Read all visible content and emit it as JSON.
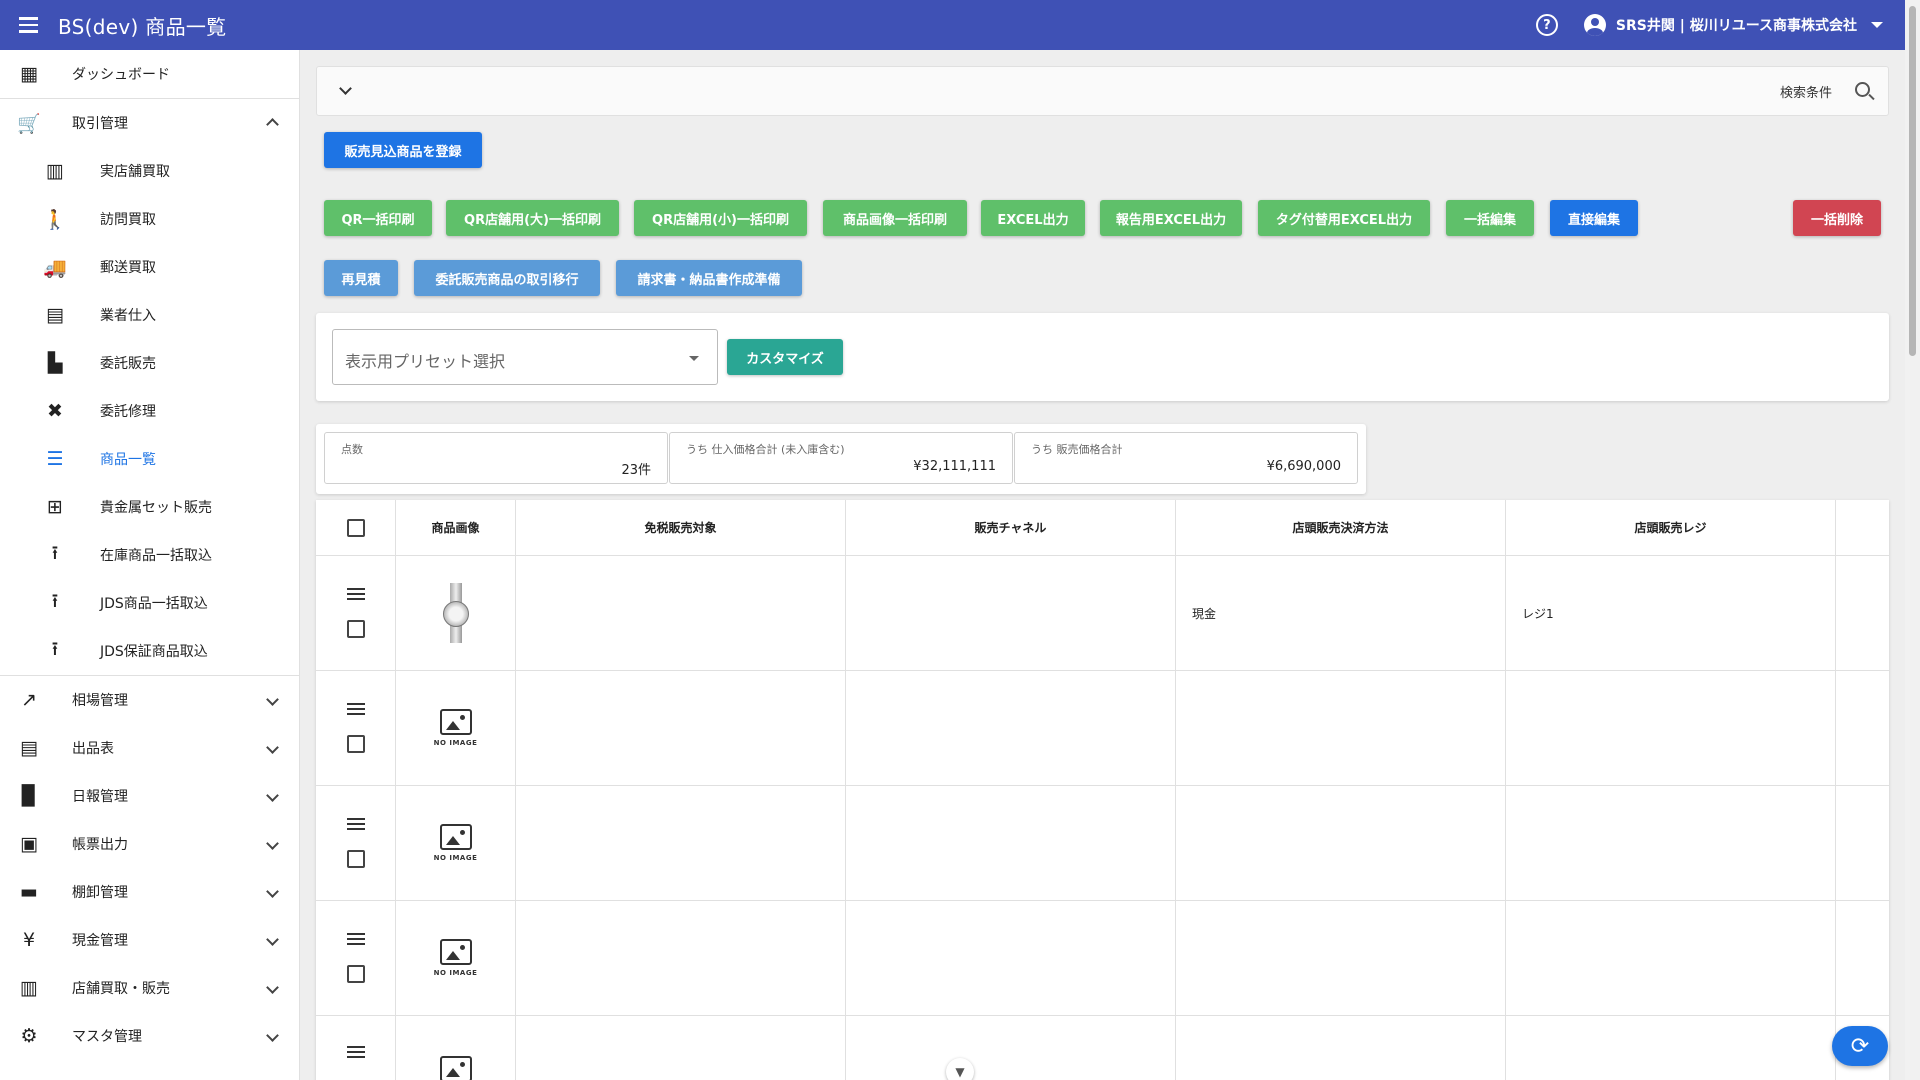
{
  "header": {
    "title": "BS(dev) 商品一覧",
    "user": "SRS井関 | 桜川リユース商事株式会社"
  },
  "sidebar": {
    "items": [
      {
        "label": "ダッシュボード",
        "icon": "dashboard-icon"
      },
      {
        "label": "取引管理",
        "icon": "cart-icon",
        "expanded": true
      },
      {
        "label": "実店舗買取",
        "icon": "store-icon"
      },
      {
        "label": "訪問買取",
        "icon": "walk-icon"
      },
      {
        "label": "郵送買取",
        "icon": "truck-icon"
      },
      {
        "label": "業者仕入",
        "icon": "building-icon"
      },
      {
        "label": "委託販売",
        "icon": "counter-icon"
      },
      {
        "label": "委託修理",
        "icon": "tools-icon"
      },
      {
        "label": "商品一覧",
        "icon": "list-icon",
        "active": true
      },
      {
        "label": "貴金属セット販売",
        "icon": "grid-icon"
      },
      {
        "label": "在庫商品一括取込",
        "icon": "upload-icon"
      },
      {
        "label": "JDS商品一括取込",
        "icon": "upload-icon"
      },
      {
        "label": "JDS保証商品取込",
        "icon": "upload-icon"
      },
      {
        "label": "相場管理",
        "icon": "trending-icon"
      },
      {
        "label": "出品表",
        "icon": "listalt-icon"
      },
      {
        "label": "日報管理",
        "icon": "document-icon"
      },
      {
        "label": "帳票出力",
        "icon": "note-icon"
      },
      {
        "label": "棚卸管理",
        "icon": "archive-icon"
      },
      {
        "label": "現金管理",
        "icon": "yen-icon"
      },
      {
        "label": "店舗買取・販売",
        "icon": "store-icon"
      },
      {
        "label": "マスタ管理",
        "icon": "gear-icon"
      }
    ]
  },
  "search": {
    "label": "検索条件"
  },
  "buttons": {
    "register": "販売見込商品を登録",
    "qr_bulk": "QR一括印刷",
    "qr_large": "QR店舗用(大)一括印刷",
    "qr_small": "QR店舗用(小)一括印刷",
    "image_bulk": "商品画像一括印刷",
    "excel": "EXCEL出力",
    "report_excel": "報告用EXCEL出力",
    "tag_excel": "タグ付替用EXCEL出力",
    "bulk_edit": "一括編集",
    "direct_edit": "直接編集",
    "bulk_delete": "一括削除",
    "requote": "再見積",
    "consign_transfer": "委託販売商品の取引移行",
    "invoice_prep": "請求書・納品書作成準備",
    "customize": "カスタマイズ"
  },
  "preset": {
    "placeholder": "表示用プリセット選択"
  },
  "stats": [
    {
      "label": "点数",
      "value": "23件"
    },
    {
      "label": "うち 仕入価格合計 (未入庫含む)",
      "value": "¥32,111,111"
    },
    {
      "label": "うち 販売価格合計",
      "value": "¥6,690,000"
    }
  ],
  "table": {
    "headers": [
      "商品画像",
      "免税販売対象",
      "販売チャネル",
      "店頭販売決済方法",
      "店頭販売レジ"
    ],
    "no_image_text": "NO IMAGE",
    "rows": [
      {
        "image": "watch",
        "tax_free": "",
        "channel": "",
        "payment": "現金",
        "register": "レジ1"
      },
      {
        "image": "none",
        "tax_free": "",
        "channel": "",
        "payment": "",
        "register": ""
      },
      {
        "image": "none",
        "tax_free": "",
        "channel": "",
        "payment": "",
        "register": ""
      },
      {
        "image": "none",
        "tax_free": "",
        "channel": "",
        "payment": "",
        "register": ""
      },
      {
        "image": "none",
        "tax_free": "",
        "channel": "",
        "payment": "",
        "register": ""
      }
    ]
  },
  "colors": {
    "appbar": "#3f51b5",
    "primary": "#1e74e4",
    "success": "#5fc06a",
    "info": "#5b9bd8",
    "danger": "#d14552",
    "teal": "#2aa694"
  }
}
